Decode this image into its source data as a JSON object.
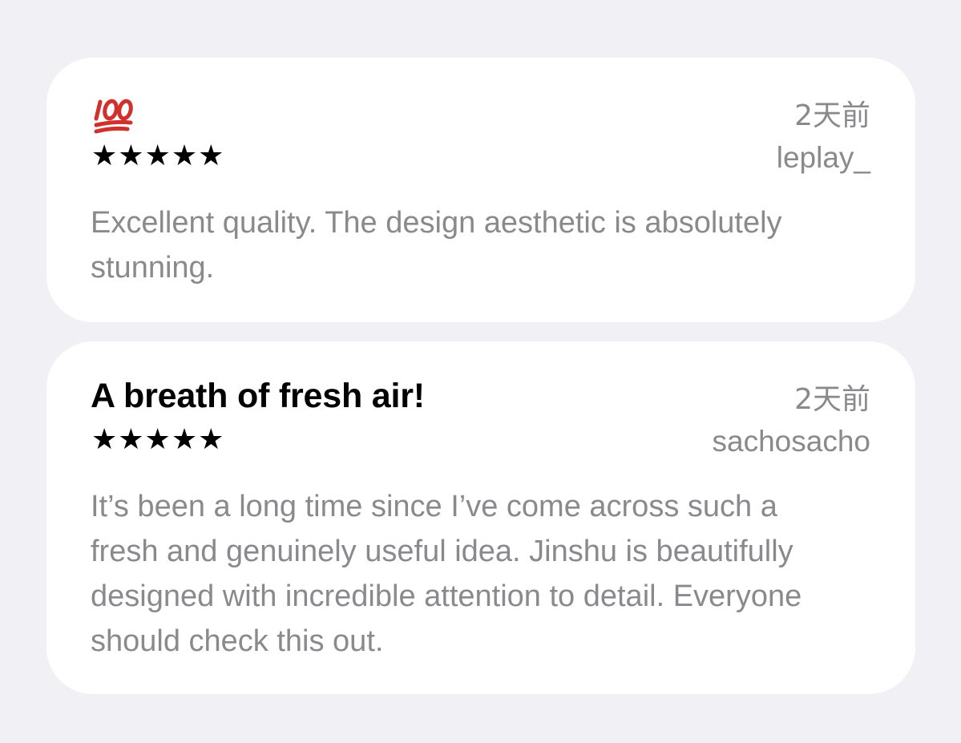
{
  "reviews": [
    {
      "title": "",
      "title_icon": "hundred-points-emoji",
      "stars": "★★★★★",
      "rating": 5,
      "date": "2天前",
      "author": "leplay_",
      "body": "Excellent quality. The design aesthetic is absolutely stunning."
    },
    {
      "title": "A breath of fresh air!",
      "stars": "★★★★★",
      "rating": 5,
      "date": "2天前",
      "author": "sachosacho",
      "body": "It’s been a long time since I’ve come across such a fresh and genuinely useful idea. Jinshu is beautifully designed with incredible attention to detail. Everyone should check this out."
    }
  ],
  "colors": {
    "background": "#f0f0f5",
    "card": "#ffffff",
    "secondary_text": "#8a8a8e",
    "primary_text": "#000000",
    "emoji_red": "#d0312d"
  }
}
